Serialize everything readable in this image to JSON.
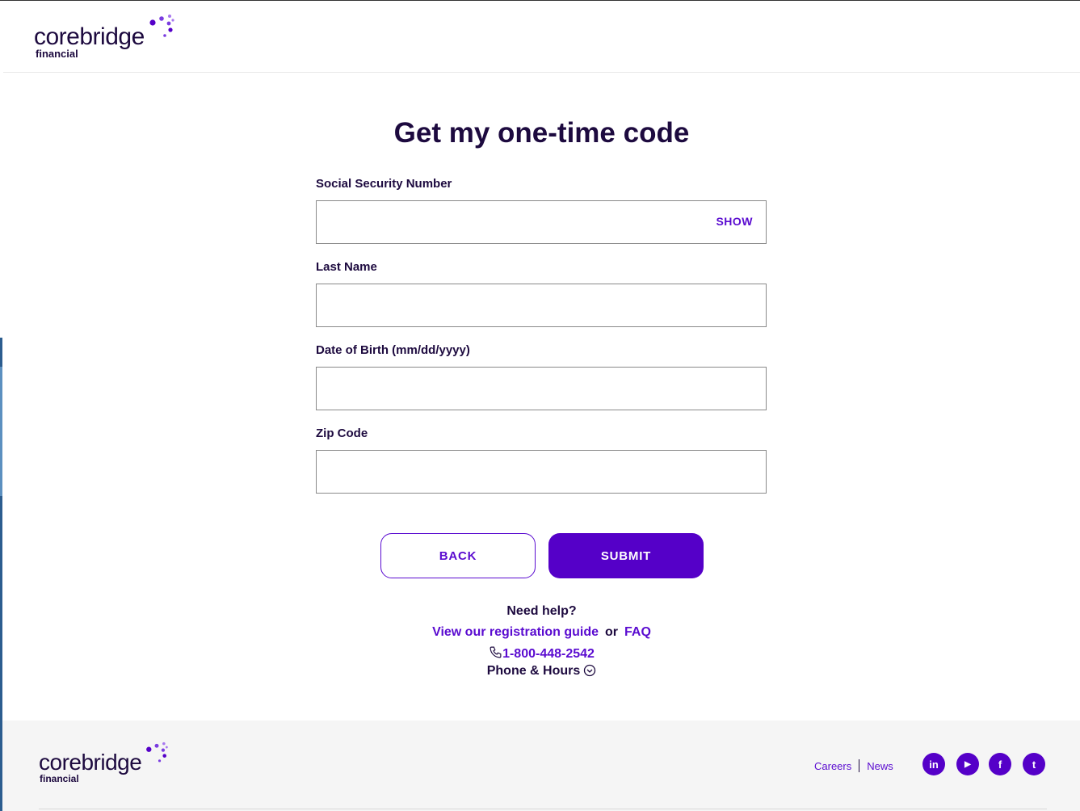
{
  "header": {
    "logo_word": "corebridge",
    "logo_sub": "financial"
  },
  "form": {
    "title": "Get my one-time code",
    "fields": [
      {
        "label": "Social Security Number",
        "value": "",
        "action": "SHOW"
      },
      {
        "label": "Last Name",
        "value": ""
      },
      {
        "label": "Date of Birth (mm/dd/yyyy)",
        "value": ""
      },
      {
        "label": "Zip Code",
        "value": ""
      }
    ],
    "back_label": "BACK",
    "submit_label": "SUBMIT"
  },
  "help": {
    "title": "Need help?",
    "guide_link": "View our registration guide",
    "or": "or",
    "faq_link": "FAQ",
    "phone": "1-800-448-2542",
    "hours": "Phone & Hours"
  },
  "footer": {
    "logo_word": "corebridge",
    "logo_sub": "financial",
    "links": [
      "Careers",
      "News"
    ],
    "social": [
      {
        "icon": "linkedin-icon",
        "glyph": "in"
      },
      {
        "icon": "youtube-icon",
        "glyph": "▶"
      },
      {
        "icon": "facebook-icon",
        "glyph": "f"
      },
      {
        "icon": "twitter-icon",
        "glyph": "t"
      }
    ]
  },
  "colors": {
    "brand_purple": "#5500c8",
    "link_purple": "#5a0bd0",
    "text_dark": "#1d0a3f"
  }
}
